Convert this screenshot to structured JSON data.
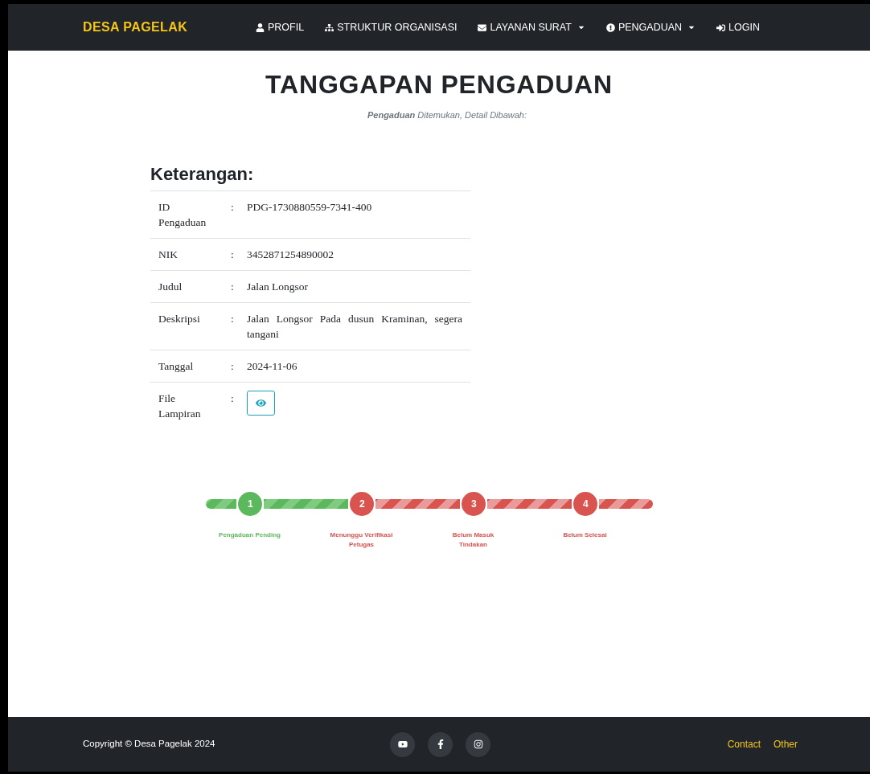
{
  "navbar": {
    "brand": "DESA PAGELAK",
    "items": [
      {
        "kind": "user",
        "label": "PROFIL",
        "dropdown": false
      },
      {
        "kind": "sitemap",
        "label": "STRUKTUR ORGANISASI",
        "dropdown": false
      },
      {
        "kind": "envelope",
        "label": "LAYANAN SURAT",
        "dropdown": true
      },
      {
        "kind": "alert",
        "label": "PENGADUAN",
        "dropdown": true
      },
      {
        "kind": "login",
        "label": "LOGIN",
        "dropdown": false
      }
    ]
  },
  "header": {
    "title": "TANGGAPAN PENGADUAN",
    "subtitle": "**Pengaduan** Ditemukan, Detail Dibawah:"
  },
  "details": {
    "heading": "Keterangan:",
    "rows": [
      {
        "kind": "text",
        "label": "ID Pengaduan",
        "separator": ":",
        "value": "PDG-1730880559-7341-400"
      },
      {
        "kind": "text",
        "label": "NIK",
        "separator": ":",
        "value": "3452871254890002"
      },
      {
        "kind": "text",
        "label": "Judul",
        "separator": ":",
        "value": "Jalan Longsor"
      },
      {
        "kind": "text",
        "label": "Deskripsi",
        "separator": ":",
        "value": "Jalan Longsor Pada dusun Kraminan, segera tangani"
      },
      {
        "kind": "text",
        "label": "Tanggal",
        "separator": ":",
        "value": "2024-11-06"
      },
      {
        "kind": "file",
        "label": "File Lampiran",
        "separator": ":"
      }
    ]
  },
  "progress": {
    "steps": [
      {
        "number": "1",
        "label": "Pengaduan Pending",
        "done": true
      },
      {
        "number": "2",
        "label": "Menunggu Verifikasi Petugas",
        "done": false
      },
      {
        "number": "3",
        "label": "Belum Masuk Tindakan",
        "done": false
      },
      {
        "number": "4",
        "label": "Belum Selesai",
        "done": false
      }
    ]
  },
  "footer": {
    "copyright": "Copyright © Desa Pagelak 2024",
    "social": [
      {
        "kind": "youtube"
      },
      {
        "kind": "facebook"
      },
      {
        "kind": "instagram"
      }
    ],
    "links": [
      "Contact",
      "Other"
    ]
  }
}
